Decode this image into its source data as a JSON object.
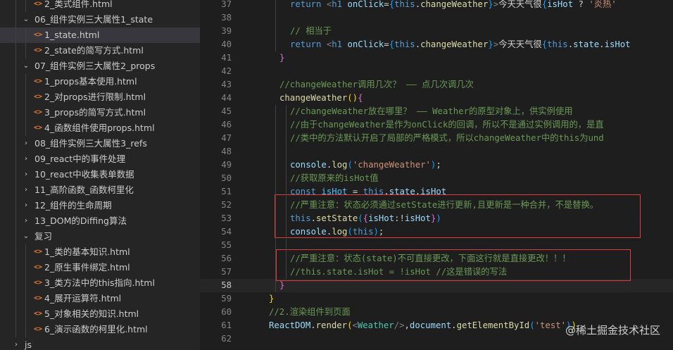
{
  "explorer": {
    "items": [
      {
        "label": "2_类式组件.html",
        "type": "file",
        "level": 2,
        "selected": false
      },
      {
        "label": "06_组件实例三大属性1_state",
        "type": "folder",
        "level": 1,
        "expanded": true
      },
      {
        "label": "1_state.html",
        "type": "file",
        "level": 2,
        "selected": true
      },
      {
        "label": "2_state的简写方式.html",
        "type": "file",
        "level": 2,
        "selected": false
      },
      {
        "label": "07_组件实例三大属性2_props",
        "type": "folder",
        "level": 1,
        "expanded": true
      },
      {
        "label": "1_props基本使用.html",
        "type": "file",
        "level": 2,
        "selected": false
      },
      {
        "label": "2_对props进行限制.html",
        "type": "file",
        "level": 2,
        "selected": false
      },
      {
        "label": "3_props的简写方式.html",
        "type": "file",
        "level": 2,
        "selected": false
      },
      {
        "label": "4_函数组件使用props.html",
        "type": "file",
        "level": 2,
        "selected": false
      },
      {
        "label": "08_组件实例三大属性3_refs",
        "type": "folder",
        "level": 1,
        "expanded": false
      },
      {
        "label": "09_react中的事件处理",
        "type": "folder",
        "level": 1,
        "expanded": false
      },
      {
        "label": "10_react中收集表单数据",
        "type": "folder",
        "level": 1,
        "expanded": false
      },
      {
        "label": "11_高阶函数_函数柯里化",
        "type": "folder",
        "level": 1,
        "expanded": false
      },
      {
        "label": "12_组件的生命周期",
        "type": "folder",
        "level": 1,
        "expanded": false
      },
      {
        "label": "13_DOM的Diffing算法",
        "type": "folder",
        "level": 1,
        "expanded": false
      },
      {
        "label": "复习",
        "type": "folder",
        "level": 1,
        "expanded": true
      },
      {
        "label": "1_类的基本知识.html",
        "type": "file",
        "level": 2,
        "selected": false
      },
      {
        "label": "2_原生事件绑定.html",
        "type": "file",
        "level": 2,
        "selected": false
      },
      {
        "label": "3_类方法中的this指向.html",
        "type": "file",
        "level": 2,
        "selected": false
      },
      {
        "label": "4_展开运算符.html",
        "type": "file",
        "level": 2,
        "selected": false
      },
      {
        "label": "5_对象相关的知识.html",
        "type": "file",
        "level": 2,
        "selected": false
      },
      {
        "label": "6_演示函数的柯里化.html",
        "type": "file",
        "level": 2,
        "selected": false
      },
      {
        "label": "js",
        "type": "folder",
        "level": 0,
        "expanded": false
      }
    ]
  },
  "editor": {
    "current_line": 58,
    "lines": [
      {
        "n": 37,
        "indent": 2,
        "tokens": [
          [
            "kw",
            "return "
          ],
          [
            "angle",
            "<"
          ],
          [
            "tag",
            "h1 "
          ],
          [
            "var",
            "onClick"
          ],
          [
            "p",
            "="
          ],
          [
            "br3",
            "{"
          ],
          [
            "kw",
            "this"
          ],
          [
            "p",
            "."
          ],
          [
            "fn",
            "changeWeather"
          ],
          [
            "br3",
            "}"
          ],
          [
            "angle",
            ">"
          ],
          [
            "p",
            "今天天气很"
          ],
          [
            "br3",
            "{"
          ],
          [
            "var",
            "isHot"
          ],
          [
            "p",
            " ? "
          ],
          [
            "str",
            "'炎热'"
          ]
        ]
      },
      {
        "n": 38,
        "indent": 0,
        "tokens": []
      },
      {
        "n": 39,
        "indent": 2,
        "tokens": [
          [
            "com",
            "// 相当于"
          ]
        ]
      },
      {
        "n": 40,
        "indent": 2,
        "tokens": [
          [
            "kw",
            "return "
          ],
          [
            "angle",
            "<"
          ],
          [
            "tag",
            "h1 "
          ],
          [
            "var",
            "onClick"
          ],
          [
            "p",
            "="
          ],
          [
            "br3",
            "{"
          ],
          [
            "kw",
            "this"
          ],
          [
            "p",
            "."
          ],
          [
            "fn",
            "changeWeather"
          ],
          [
            "br3",
            "}"
          ],
          [
            "angle",
            ">"
          ],
          [
            "p",
            "今天天气很"
          ],
          [
            "br3",
            "{"
          ],
          [
            "kw",
            "this"
          ],
          [
            "p",
            "."
          ],
          [
            "var",
            "state"
          ],
          [
            "p",
            "."
          ],
          [
            "var",
            "isHot"
          ]
        ]
      },
      {
        "n": 41,
        "indent": 1,
        "tokens": [
          [
            "brace",
            "}"
          ]
        ]
      },
      {
        "n": 42,
        "indent": 0,
        "tokens": []
      },
      {
        "n": 43,
        "indent": 1,
        "tokens": [
          [
            "com",
            "//changeWeather调用几次？ —— 点几次调几次"
          ]
        ]
      },
      {
        "n": 44,
        "indent": 1,
        "tokens": [
          [
            "fn",
            "changeWeather"
          ],
          [
            "br2",
            "()"
          ],
          [
            "brace",
            "{"
          ]
        ]
      },
      {
        "n": 45,
        "indent": 2,
        "tokens": [
          [
            "com",
            "//changeWeather放在哪里？ —— Weather的原型对象上，供实例使用"
          ]
        ]
      },
      {
        "n": 46,
        "indent": 2,
        "tokens": [
          [
            "com",
            "//由于changeWeather是作为onClick的回调，所以不是通过实例调用的，是直"
          ]
        ]
      },
      {
        "n": 47,
        "indent": 2,
        "tokens": [
          [
            "com",
            "//类中的方法默认开启了局部的严格模式，所以changeWeather中的this为und"
          ]
        ]
      },
      {
        "n": 48,
        "indent": 0,
        "tokens": []
      },
      {
        "n": 49,
        "indent": 2,
        "tokens": [
          [
            "var",
            "console"
          ],
          [
            "p",
            "."
          ],
          [
            "fn",
            "log"
          ],
          [
            "br3",
            "("
          ],
          [
            "str",
            "'changeWeather'"
          ],
          [
            "br3",
            ")"
          ],
          [
            "p",
            ";"
          ]
        ]
      },
      {
        "n": 50,
        "indent": 2,
        "tokens": [
          [
            "com",
            "//获取原来的isHot值"
          ]
        ]
      },
      {
        "n": 51,
        "indent": 2,
        "tokens": [
          [
            "kw",
            "const "
          ],
          [
            "const",
            "isHot"
          ],
          [
            "p",
            " = "
          ],
          [
            "kw",
            "this"
          ],
          [
            "p",
            "."
          ],
          [
            "var",
            "state"
          ],
          [
            "p",
            "."
          ],
          [
            "var",
            "isHot"
          ]
        ]
      },
      {
        "n": 52,
        "indent": 2,
        "tokens": [
          [
            "com",
            "//严重注意：状态必须通过setState进行更新,且更新是一种合并，不是替换。"
          ]
        ]
      },
      {
        "n": 53,
        "indent": 2,
        "tokens": [
          [
            "kw",
            "this"
          ],
          [
            "p",
            "."
          ],
          [
            "fn",
            "setState"
          ],
          [
            "br3",
            "("
          ],
          [
            "brace",
            "{"
          ],
          [
            "var",
            "isHot"
          ],
          [
            "p",
            ":!"
          ],
          [
            "var",
            "isHot"
          ],
          [
            "brace",
            "}"
          ],
          [
            "br3",
            ")"
          ]
        ]
      },
      {
        "n": 54,
        "indent": 2,
        "tokens": [
          [
            "var",
            "console"
          ],
          [
            "p",
            "."
          ],
          [
            "fn",
            "log"
          ],
          [
            "br3",
            "("
          ],
          [
            "kw",
            "this"
          ],
          [
            "br3",
            ")"
          ],
          [
            "p",
            ";"
          ]
        ]
      },
      {
        "n": 55,
        "indent": 0,
        "tokens": []
      },
      {
        "n": 56,
        "indent": 2,
        "tokens": [
          [
            "com",
            "//严重注意：状态(state)不可直接更改，下面这行就是直接更改！！！"
          ]
        ]
      },
      {
        "n": 57,
        "indent": 2,
        "tokens": [
          [
            "com",
            "//this.state.isHot = !isHot //这是错误的写法"
          ]
        ]
      },
      {
        "n": 58,
        "indent": 1,
        "tokens": [
          [
            "brace",
            "}"
          ]
        ]
      },
      {
        "n": 59,
        "indent": 0,
        "tokens": [
          [
            "br2",
            "}"
          ]
        ]
      },
      {
        "n": 60,
        "indent": 0,
        "tokens": [
          [
            "com",
            "//2.渲染组件到页面"
          ]
        ]
      },
      {
        "n": 61,
        "indent": 0,
        "tokens": [
          [
            "var",
            "ReactDOM"
          ],
          [
            "p",
            "."
          ],
          [
            "fn",
            "render"
          ],
          [
            "br2",
            "("
          ],
          [
            "angle",
            "<"
          ],
          [
            "comp",
            "Weather"
          ],
          [
            "angle",
            "/>"
          ],
          [
            "p",
            ","
          ],
          [
            "var",
            "document"
          ],
          [
            "p",
            "."
          ],
          [
            "fn",
            "getElementById"
          ],
          [
            "br3",
            "("
          ],
          [
            "str",
            "'test'"
          ],
          [
            "br3",
            ")"
          ],
          [
            "br2",
            ")"
          ]
        ]
      },
      {
        "n": 62,
        "indent": 0,
        "tokens": []
      }
    ]
  },
  "watermark": "@稀土掘金技术社区"
}
